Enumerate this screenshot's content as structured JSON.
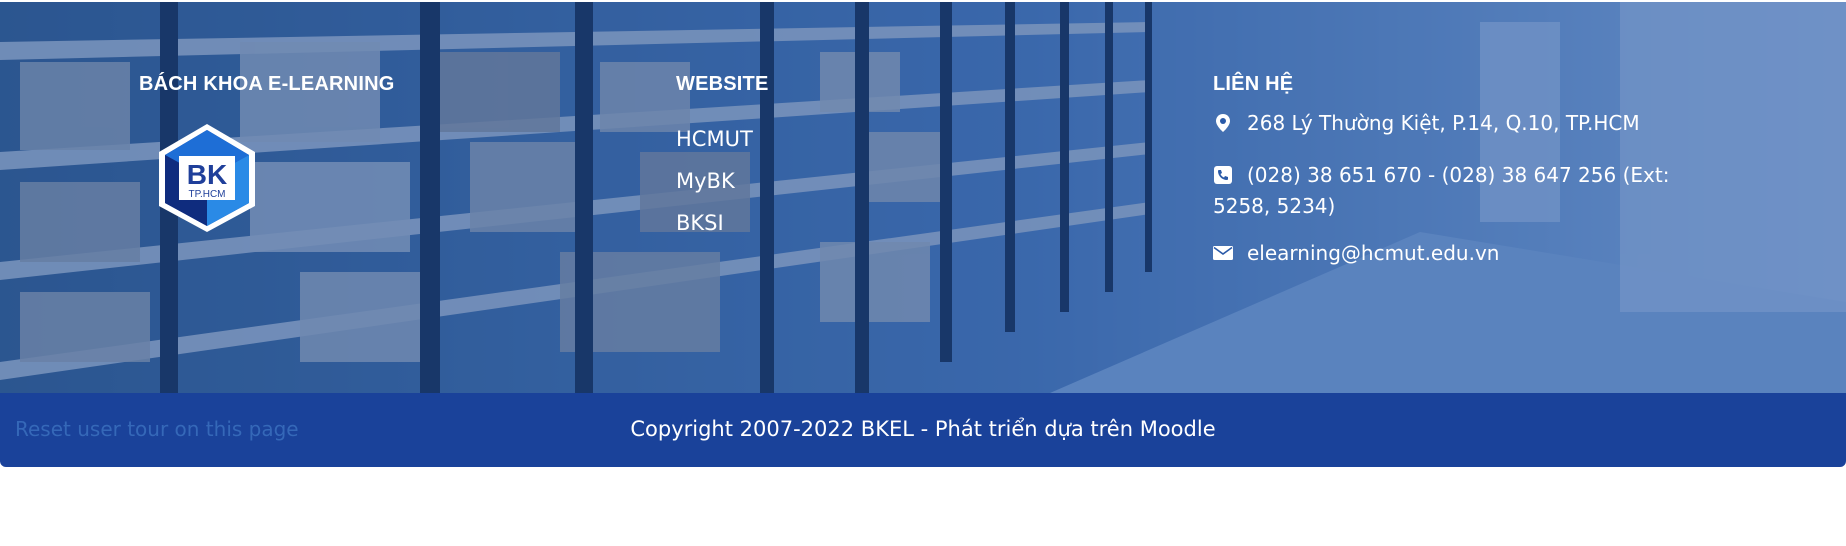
{
  "brand": {
    "heading": "BÁCH KHOA E-LEARNING",
    "logo_text_main": "BK",
    "logo_text_sub": "TP.HCM"
  },
  "websites": {
    "heading": "WEBSITE",
    "links": [
      "HCMUT",
      "MyBK",
      "BKSI"
    ]
  },
  "contact": {
    "heading": "LIÊN HỆ",
    "address": "268 Lý Thường Kiệt, P.14, Q.10, TP.HCM",
    "phone": "(028) 38 651 670 - (028) 38 647 256 (Ext: 5258, 5234)",
    "email": "elearning@hcmut.edu.vn",
    "address_icon": "map-marker-icon",
    "phone_icon": "phone-icon",
    "email_icon": "envelope-icon"
  },
  "bottom_bar": {
    "reset_tour": "Reset user tour on this page",
    "copyright": "Copyright 2007-2022 BKEL - Phát triển dựa trên Moodle"
  },
  "colors": {
    "overlay": "#1c4fa0",
    "bottom_bar": "#1a429a",
    "reset_link": "#3568b8",
    "text": "#ffffff"
  }
}
